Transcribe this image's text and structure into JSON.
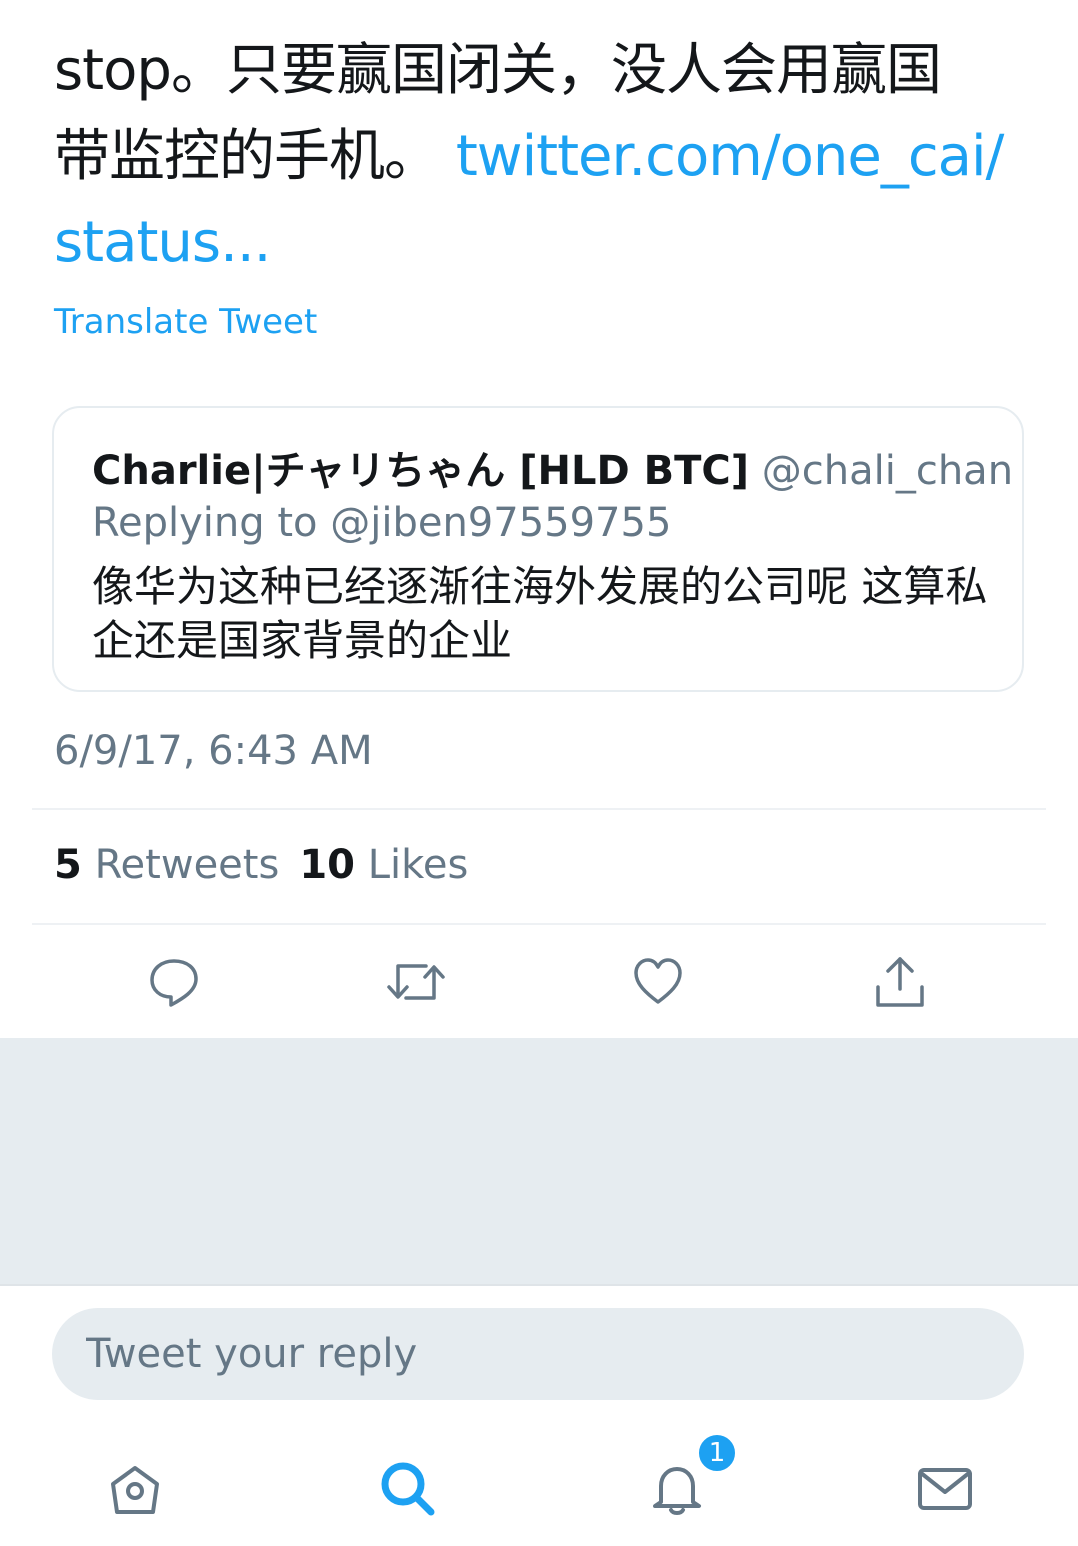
{
  "tweet": {
    "text_lines": [
      "stop。只要赢国闭关，没人会用赢国",
      "带监控的手机。 "
    ],
    "link_part1": "twitter.com/one_cai/",
    "link_part2": "status...",
    "translate_label": "Translate Tweet"
  },
  "quoted_tweet": {
    "name": "Charlie|チャリちゃん [HLD BTC]",
    "handle": "@chali_chan",
    "replying_to": "Replying to @jiben97559755",
    "text": "像华为这种已经逐渐往海外发展的公司呢 这算私企还是国家背景的企业"
  },
  "timestamp": "6/9/17, 6:43 AM",
  "stats": {
    "retweets_count": "5",
    "retweets_label": "Retweets",
    "likes_count": "10",
    "likes_label": "Likes"
  },
  "actions": [
    "reply-icon",
    "retweet-icon",
    "like-icon",
    "share-icon"
  ],
  "reply_box": {
    "placeholder": "Tweet your reply"
  },
  "bottom_nav": {
    "items": [
      "home-icon",
      "search-icon",
      "notifications-icon",
      "messages-icon"
    ],
    "notification_badge": "1"
  },
  "colors": {
    "accent": "#1da1f2",
    "text": "#14171a",
    "secondary": "#657786",
    "background_gray": "#e6ecf0"
  }
}
